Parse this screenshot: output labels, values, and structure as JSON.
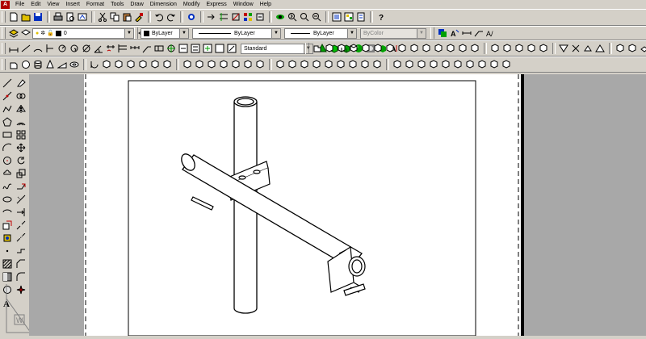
{
  "menubar": {
    "items": [
      "File",
      "Edit",
      "View",
      "Insert",
      "Format",
      "Tools",
      "Draw",
      "Dimension",
      "Modify",
      "Express",
      "Window",
      "Help"
    ]
  },
  "layers_toolbar": {
    "layer_value": "0"
  },
  "properties_toolbar": {
    "color_value": "ByLayer",
    "linetype_value": "ByLayer",
    "lineweight_value": "ByLayer",
    "plotstyle_value": "ByColor"
  },
  "styles_toolbar": {
    "text_style_value": "Standard"
  },
  "ucs_icon": {
    "label": "W"
  },
  "colors": {
    "accent_green": "#00a000",
    "accent_blue": "#0030c0",
    "accent_red": "#c00000",
    "accent_yellow": "#e0c000"
  }
}
